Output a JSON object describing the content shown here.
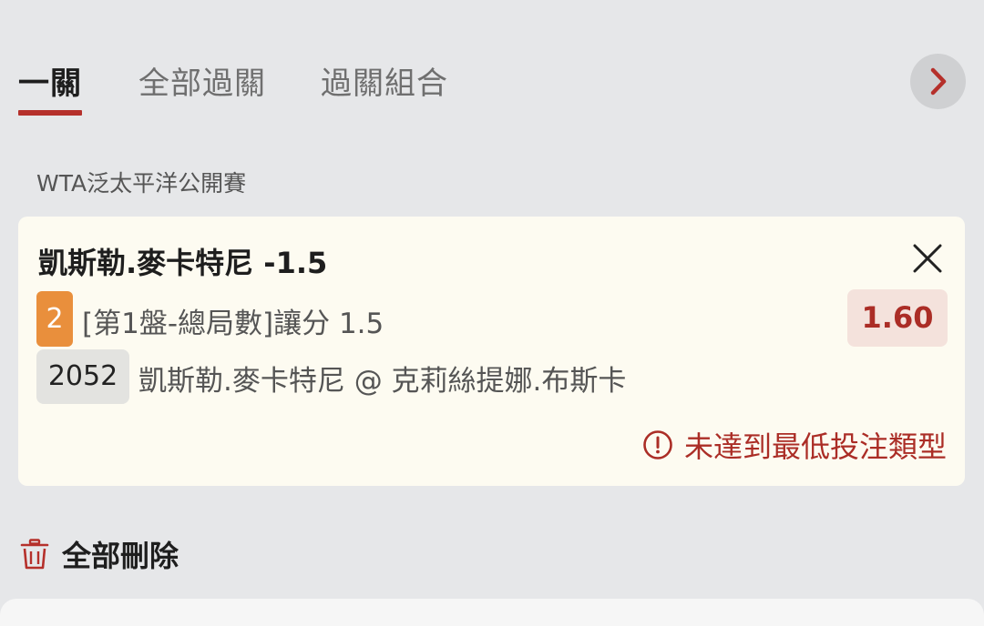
{
  "tabs": [
    {
      "label": "一關",
      "active": true
    },
    {
      "label": "全部過關",
      "active": false
    },
    {
      "label": "過關組合",
      "active": false
    }
  ],
  "icons": {
    "next": "chevron-right-icon",
    "close": "close-icon",
    "warning": "warning-circle-icon",
    "delete": "trash-icon"
  },
  "league": "WTA泛太平洋公開賽",
  "selection": {
    "title": "凱斯勒.麥卡特尼 -1.5",
    "number_badge": "2",
    "market": "[第1盤-總局數]讓分 1.5",
    "odds": "1.60",
    "match_code": "2052",
    "match": "凱斯勒.麥卡特尼 @ 克莉絲提娜.布斯卡",
    "warning": "未達到最低投注類型"
  },
  "actions": {
    "delete_all": "全部刪除"
  },
  "colors": {
    "accent": "#b5302b",
    "badge_orange": "#e98f3c",
    "card_bg": "#fdfbf1",
    "page_bg": "#e6e7e9"
  }
}
